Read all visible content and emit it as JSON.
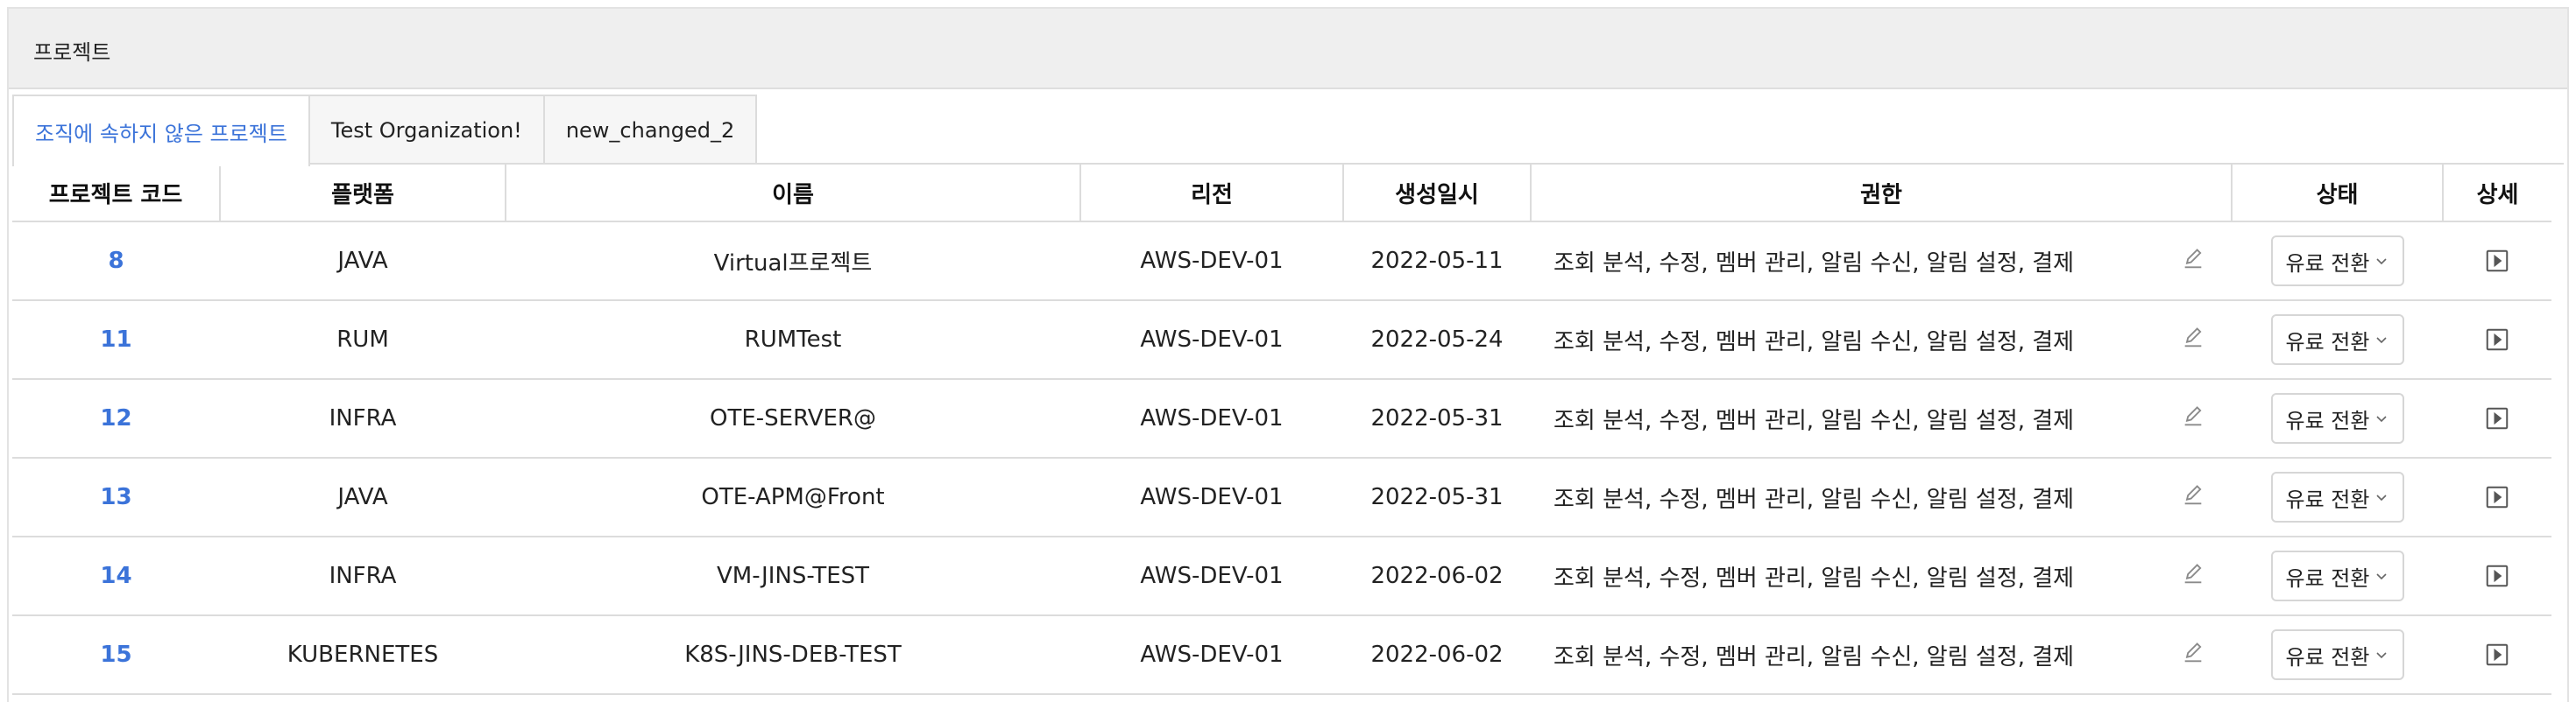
{
  "panel": {
    "title": "프로젝트"
  },
  "tabs": [
    {
      "label": "조직에 속하지 않은 프로젝트",
      "active": true
    },
    {
      "label": "Test Organization!",
      "active": false
    },
    {
      "label": "new_changed_2",
      "active": false
    }
  ],
  "colors": {
    "accent": "#3b73d9",
    "border": "#dcdcdc",
    "header_bg": "#efefef",
    "icon": "#8a8a8a"
  },
  "table": {
    "headers": [
      "프로젝트 코드",
      "플랫폼",
      "이름",
      "리전",
      "생성일시",
      "권한",
      "상태",
      "상세"
    ],
    "rows": [
      {
        "code": "8",
        "platform": "JAVA",
        "name": "Virtual프로젝트",
        "region": "AWS-DEV-01",
        "created": "2022-05-11",
        "permissions": "조회 분석, 수정, 멤버 관리, 알림 수신, 알림 설정, 결제",
        "status": "유료 전환"
      },
      {
        "code": "11",
        "platform": "RUM",
        "name": "RUMTest",
        "region": "AWS-DEV-01",
        "created": "2022-05-24",
        "permissions": "조회 분석, 수정, 멤버 관리, 알림 수신, 알림 설정, 결제",
        "status": "유료 전환"
      },
      {
        "code": "12",
        "platform": "INFRA",
        "name": "OTE-SERVER@",
        "region": "AWS-DEV-01",
        "created": "2022-05-31",
        "permissions": "조회 분석, 수정, 멤버 관리, 알림 수신, 알림 설정, 결제",
        "status": "유료 전환"
      },
      {
        "code": "13",
        "platform": "JAVA",
        "name": "OTE-APM@Front",
        "region": "AWS-DEV-01",
        "created": "2022-05-31",
        "permissions": "조회 분석, 수정, 멤버 관리, 알림 수신, 알림 설정, 결제",
        "status": "유료 전환"
      },
      {
        "code": "14",
        "platform": "INFRA",
        "name": "VM-JINS-TEST",
        "region": "AWS-DEV-01",
        "created": "2022-06-02",
        "permissions": "조회 분석, 수정, 멤버 관리, 알림 수신, 알림 설정, 결제",
        "status": "유료 전환"
      },
      {
        "code": "15",
        "platform": "KUBERNETES",
        "name": "K8S-JINS-DEB-TEST",
        "region": "AWS-DEV-01",
        "created": "2022-06-02",
        "permissions": "조회 분석, 수정, 멤버 관리, 알림 수신, 알림 설정, 결제",
        "status": "유료 전환"
      }
    ]
  },
  "icons": {
    "edit": "pencil-icon",
    "status_caret": "chevron-down-icon",
    "detail": "play-square-icon"
  }
}
